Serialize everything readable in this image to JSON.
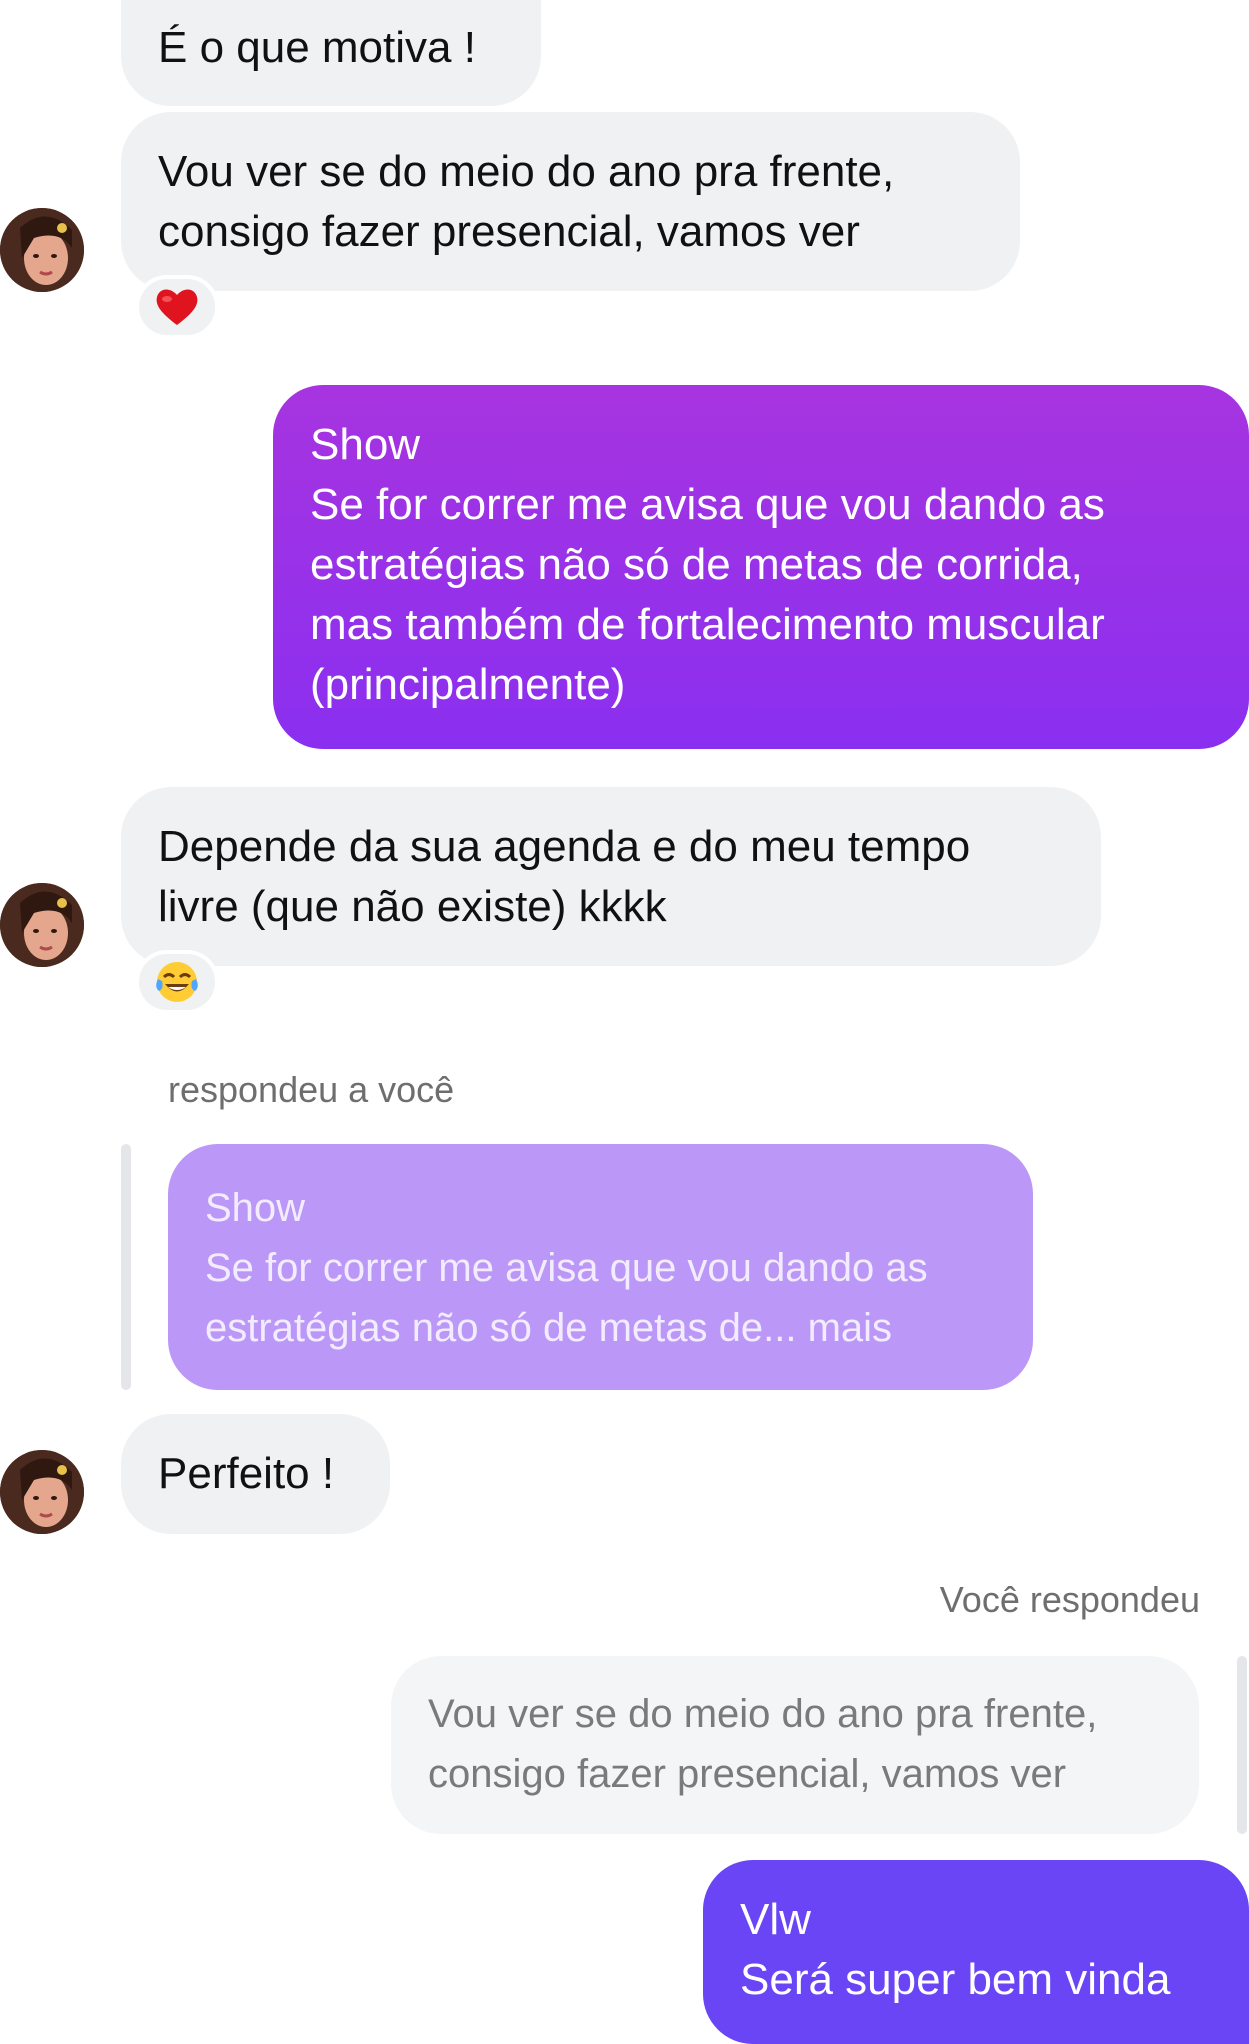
{
  "messages": {
    "m1": {
      "text": "É o que motiva !"
    },
    "m2": {
      "text": "Vou ver se do meio do ano pra frente,\nconsigo fazer presencial, vamos ver",
      "reaction_icon": "heart-emoji"
    },
    "m3": {
      "text": "Show\nSe for correr me avisa que vou dando as\nestratégias não só de metas de corrida,\nmas também de fortalecimento muscular\n(principalmente)"
    },
    "m4": {
      "text": "Depende da sua agenda e do meu tempo\nlivre (que não existe) kkkk",
      "reaction_icon": "tears-of-joy-emoji"
    },
    "m5": {
      "reply_label": "respondeu a você",
      "quoted_text": "Show\nSe for correr me avisa que vou dando as\nestratégias não só de metas de... mais",
      "text": "Perfeito !"
    },
    "m6": {
      "reply_label": "Você respondeu",
      "quoted_text": "Vou ver se do meio do ano pra frente,\nconsigo fazer presencial, vamos ver",
      "text": "Vlw\nSerá super bem vinda"
    }
  },
  "colors": {
    "incoming_bg": "#eff1f3",
    "outgoing_purple_top": "#a734e0",
    "outgoing_purple_bottom": "#8a2ff0",
    "quoted_outgoing_bg": "#bb98f8",
    "outgoing_blue": "#6a45f5"
  }
}
